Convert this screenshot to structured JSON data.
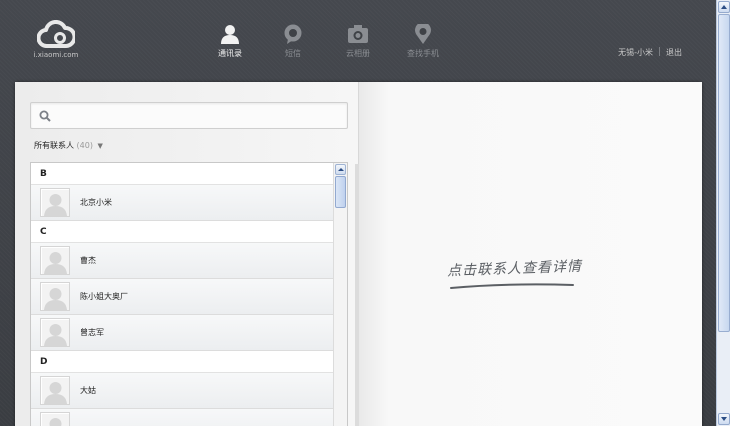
{
  "header": {
    "logo_text": "i.xiaomi.com",
    "nav": [
      {
        "label": "通讯录",
        "icon": "person-icon",
        "active": true
      },
      {
        "label": "短信",
        "icon": "chat-bubble-icon",
        "active": false
      },
      {
        "label": "云相册",
        "icon": "camera-icon",
        "active": false
      },
      {
        "label": "查找手机",
        "icon": "location-pin-icon",
        "active": false
      }
    ],
    "user_name": "无锡-小米",
    "logout": "退出"
  },
  "sidebar": {
    "search_placeholder": "",
    "filter_label": "所有联系人",
    "filter_count": "(40)",
    "groups": [
      {
        "letter": "B",
        "contacts": [
          "北京小米"
        ]
      },
      {
        "letter": "C",
        "contacts": [
          "曹杰",
          "陈小姐大奥厂",
          "曾志军"
        ]
      },
      {
        "letter": "D",
        "contacts": [
          "大姑"
        ]
      }
    ]
  },
  "detail": {
    "hint": "点击联系人查看详情"
  },
  "colors": {
    "topbar": "#3d4046",
    "panel": "#f2f2f2",
    "nav_active": "#f2f2f2",
    "nav_inactive": "#8a8d92"
  }
}
